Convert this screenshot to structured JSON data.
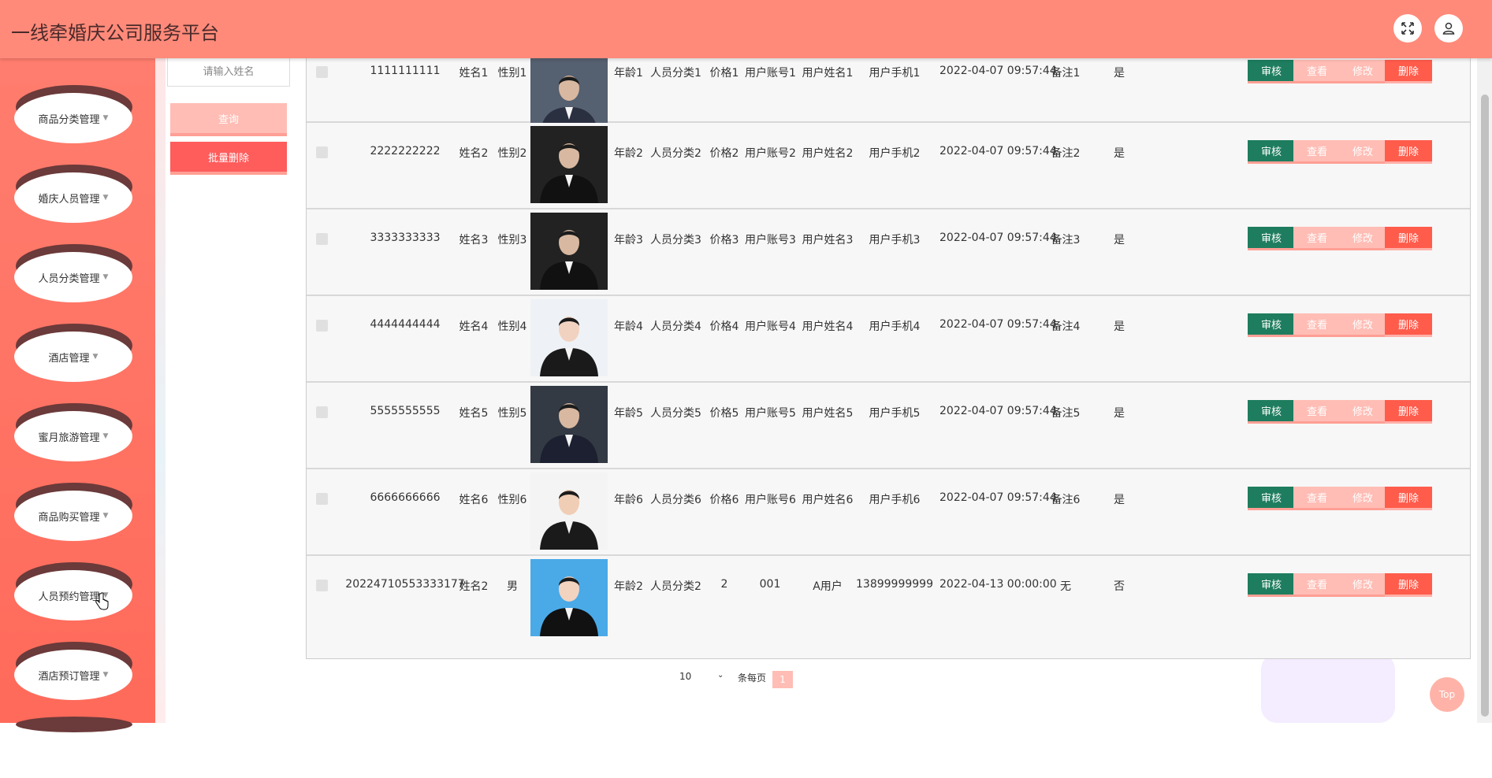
{
  "header": {
    "title": "一线牵婚庆公司服务平台"
  },
  "sidebar": {
    "items": [
      {
        "label": "商品分类管理"
      },
      {
        "label": "婚庆人员管理"
      },
      {
        "label": "人员分类管理"
      },
      {
        "label": "酒店管理"
      },
      {
        "label": "蜜月旅游管理"
      },
      {
        "label": "商品购买管理"
      },
      {
        "label": "人员预约管理"
      },
      {
        "label": "酒店预订管理"
      }
    ]
  },
  "filter": {
    "name_placeholder": "请输入姓名",
    "query_label": "查询",
    "batch_delete_label": "批量删除"
  },
  "actions": {
    "audit": "审核",
    "view": "查看",
    "edit": "修改",
    "delete": "删除"
  },
  "rows": [
    {
      "id": "1111111111",
      "name": "姓名1",
      "gender": "性别1",
      "age": "年龄1",
      "category": "人员分类1",
      "price": "价格1",
      "account": "用户账号1",
      "username": "用户姓名1",
      "phone": "用户手机1",
      "time": "2022-04-07 09:57:44",
      "note": "备注1",
      "flag": "是"
    },
    {
      "id": "2222222222",
      "name": "姓名2",
      "gender": "性别2",
      "age": "年龄2",
      "category": "人员分类2",
      "price": "价格2",
      "account": "用户账号2",
      "username": "用户姓名2",
      "phone": "用户手机2",
      "time": "2022-04-07 09:57:44",
      "note": "备注2",
      "flag": "是"
    },
    {
      "id": "3333333333",
      "name": "姓名3",
      "gender": "性别3",
      "age": "年龄3",
      "category": "人员分类3",
      "price": "价格3",
      "account": "用户账号3",
      "username": "用户姓名3",
      "phone": "用户手机3",
      "time": "2022-04-07 09:57:44",
      "note": "备注3",
      "flag": "是"
    },
    {
      "id": "4444444444",
      "name": "姓名4",
      "gender": "性别4",
      "age": "年龄4",
      "category": "人员分类4",
      "price": "价格4",
      "account": "用户账号4",
      "username": "用户姓名4",
      "phone": "用户手机4",
      "time": "2022-04-07 09:57:44",
      "note": "备注4",
      "flag": "是"
    },
    {
      "id": "5555555555",
      "name": "姓名5",
      "gender": "性别5",
      "age": "年龄5",
      "category": "人员分类5",
      "price": "价格5",
      "account": "用户账号5",
      "username": "用户姓名5",
      "phone": "用户手机5",
      "time": "2022-04-07 09:57:44",
      "note": "备注5",
      "flag": "是"
    },
    {
      "id": "6666666666",
      "name": "姓名6",
      "gender": "性别6",
      "age": "年龄6",
      "category": "人员分类6",
      "price": "价格6",
      "account": "用户账号6",
      "username": "用户姓名6",
      "phone": "用户手机6",
      "time": "2022-04-07 09:57:44",
      "note": "备注6",
      "flag": "是"
    },
    {
      "id": "20224710553333177",
      "name": "姓名2",
      "gender": "男",
      "age": "年龄2",
      "category": "人员分类2",
      "price": "2",
      "account": "001",
      "username": "A用户",
      "phone": "13899999999",
      "time": "2022-04-13 00:00:00",
      "note": "无",
      "flag": "否"
    }
  ],
  "pagination": {
    "page_size": "10",
    "per_page_label": "条每页",
    "current_page": "1"
  },
  "top_button": "Top",
  "colors": {
    "header": "#ff8a7a",
    "sidebar": "#ff6a5a",
    "audit": "#1e7d5e",
    "delete": "#ff5c4c",
    "soft": "#ffbdb5"
  },
  "icons": {
    "fullscreen": "expand-icon",
    "user": "user-icon"
  }
}
